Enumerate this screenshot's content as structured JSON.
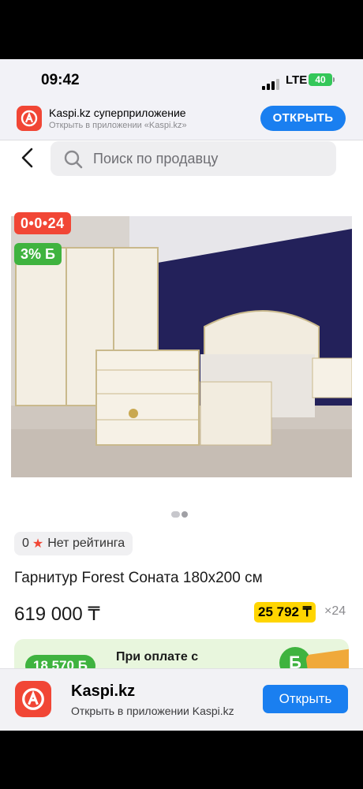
{
  "status_bar": {
    "time": "09:42",
    "network": "LTE",
    "battery": "40"
  },
  "app_banner": {
    "title": "Kaspi.kz суперприложение",
    "subtitle": "Открыть в приложении «Kaspi.kz»",
    "button": "ОТКРЫТЬ"
  },
  "search": {
    "placeholder": "Поиск по продавцу"
  },
  "product": {
    "badge_installment": "0•0•24",
    "badge_bonus": "3% Б",
    "rating_count": "0",
    "rating_text": "Нет рейтинга",
    "title": "Гарнитур Forest Соната 180х200 см",
    "price": "619 000 ₸",
    "monthly": "25 792 ₸",
    "months": "×24"
  },
  "promo": {
    "badge": "18 570 Б",
    "text": "При оплате с",
    "coin": "Б"
  },
  "bottom_banner": {
    "title": "Kaspi.kz",
    "subtitle": "Открыть в приложении Kaspi.kz",
    "button": "Открыть"
  },
  "colors": {
    "accent": "#1a7ff0",
    "brand": "#f14635",
    "bonus": "#3fb33f",
    "installment": "#ffd500"
  }
}
